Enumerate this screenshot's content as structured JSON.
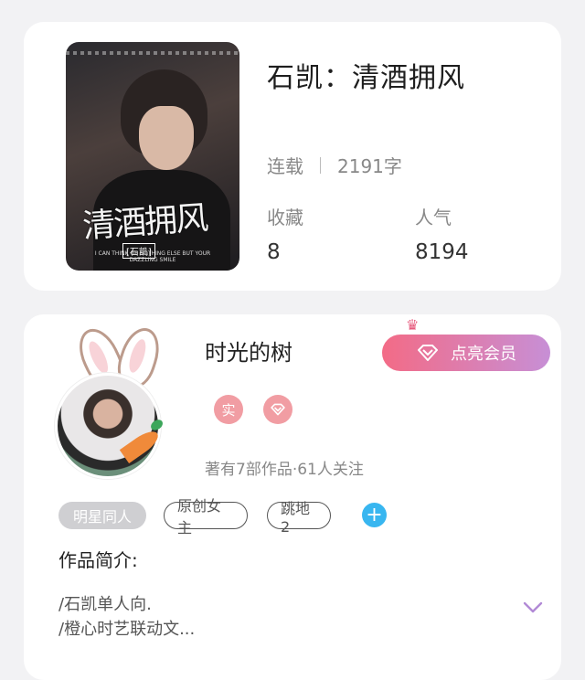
{
  "book": {
    "cover_title_art": "清酒拥风",
    "cover_sub_tag": "[石凯]",
    "cover_small_text": "I CAN THINK OF NOTHING ELSE BUT YOUR DAZZLING SMILE",
    "title": "石凯：清酒拥风",
    "status": "连载",
    "word_count": "2191字",
    "favorites_label": "收藏",
    "favorites_value": "8",
    "popularity_label": "人气",
    "popularity_value": "8194"
  },
  "author": {
    "name": "时光的树",
    "vip_button_label": "点亮会员",
    "badge_real": "实",
    "info": "著有7部作品·61人关注",
    "tags": [
      "明星同人",
      "原创女主",
      "跳地2"
    ],
    "add_tag_symbol": "+",
    "intro_label": "作品简介:",
    "intro_lines": [
      "/石凯单人向.",
      "/橙心时艺联动文..."
    ]
  },
  "colors": {
    "vip_gradient_start": "#f36b86",
    "vip_gradient_end": "#c78fd6",
    "badge_pink": "#f19da3",
    "plus_blue": "#38b6f0",
    "expand_purple": "#b28ad6"
  },
  "icons": [
    "crown-icon",
    "diamond-icon",
    "plus-icon",
    "chevron-down-icon"
  ]
}
